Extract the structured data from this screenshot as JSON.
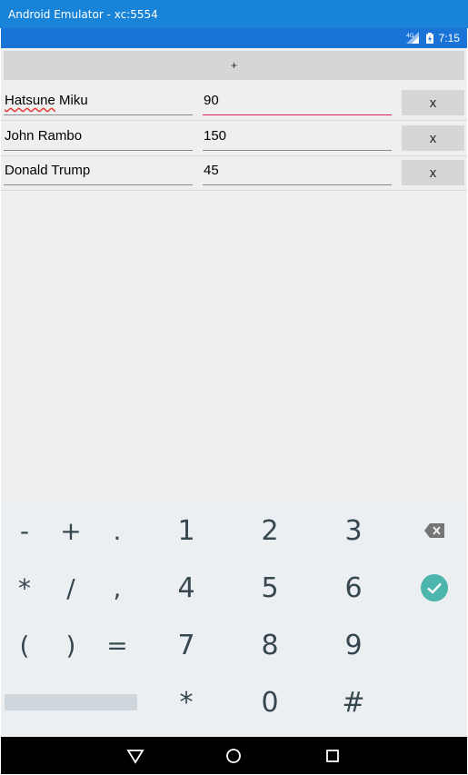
{
  "window": {
    "title": "Android Emulator - xc:5554"
  },
  "statusbar": {
    "time": "7:15",
    "network": "4G"
  },
  "add_button_label": "+",
  "rows": [
    {
      "name": "Hatsune Miku",
      "name_first": "Hatsune",
      "name_rest": " Miku",
      "value": "90",
      "remove_label": "x"
    },
    {
      "name": "John Rambo",
      "value": "150",
      "remove_label": "x"
    },
    {
      "name": "Donald Trump",
      "value": "45",
      "remove_label": "x"
    }
  ],
  "keyboard": {
    "symbols": [
      "-",
      "+",
      ".",
      "*",
      "/",
      ",",
      "(",
      ")",
      "="
    ],
    "digits": [
      "1",
      "2",
      "3",
      "4",
      "5",
      "6",
      "7",
      "8",
      "9",
      "*",
      "0",
      "#"
    ],
    "backspace_icon": "backspace-icon",
    "done_icon": "check-circle-icon",
    "accent": "#4db6ac"
  },
  "colors": {
    "titlebar": "#1883d7",
    "statusbar": "#1a73d6",
    "focus_underline": "#d81b60",
    "spell_error": "#e53935"
  }
}
